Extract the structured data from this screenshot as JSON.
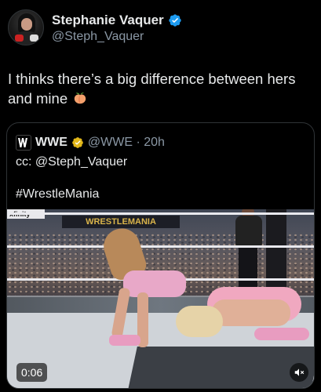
{
  "author": {
    "display_name": "Stephanie Vaquer",
    "handle": "@Steph_Vaquer",
    "avatar_icon": "profile-avatar",
    "verified_icon": "verified-blue-badge"
  },
  "tweet": {
    "text": "I thinks there’s a big difference between hers and mine",
    "emoji_icon": "peach-emoji"
  },
  "quoted": {
    "logo_icon": "wwe-logo",
    "name": "WWE",
    "badge_icon": "verified-gold-badge",
    "handle_time": "@WWE · 20h",
    "line1": "cc: @Steph_Vaquer",
    "line2": "#WrestleMania",
    "video": {
      "duration": "0:06",
      "sound_icon": "muted-speaker-icon",
      "signage_text": "WRESTLEMANIA",
      "xfinity_text": "xfinity"
    }
  },
  "colors": {
    "background": "#000000",
    "text": "#e7e9ea",
    "muted": "#8b98a5",
    "verified_blue": "#1d9bf0",
    "verified_gold": "#e2b719",
    "border": "#2f3336"
  }
}
